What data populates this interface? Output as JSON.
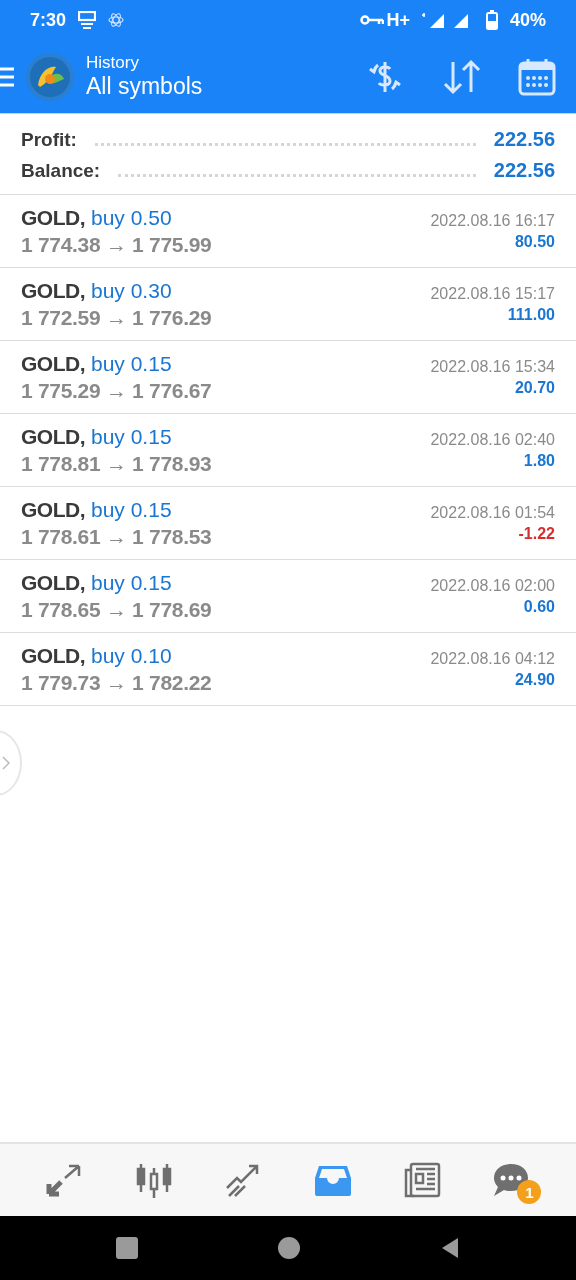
{
  "status_bar": {
    "time": "7:30",
    "network": "H+",
    "battery": "40%"
  },
  "header": {
    "title": "History",
    "subtitle": "All symbols"
  },
  "summary": [
    {
      "label": "Profit:",
      "value": "222.56"
    },
    {
      "label": "Balance:",
      "value": "222.56"
    }
  ],
  "trades": [
    {
      "symbol": "GOLD,",
      "type": "buy 0.50",
      "prices": "1 774.38 → 1 775.99",
      "time": "2022.08.16 16:17",
      "profit": "80.50",
      "color": "#1976d2"
    },
    {
      "symbol": "GOLD,",
      "type": "buy 0.30",
      "prices": "1 772.59 → 1 776.29",
      "time": "2022.08.16 15:17",
      "profit": "111.00",
      "color": "#1976d2"
    },
    {
      "symbol": "GOLD,",
      "type": "buy 0.15",
      "prices": "1 775.29 → 1 776.67",
      "time": "2022.08.16 15:34",
      "profit": "20.70",
      "color": "#1976d2"
    },
    {
      "symbol": "GOLD,",
      "type": "buy 0.15",
      "prices": "1 778.81 → 1 778.93",
      "time": "2022.08.16 02:40",
      "profit": "1.80",
      "color": "#1976d2"
    },
    {
      "symbol": "GOLD,",
      "type": "buy 0.15",
      "prices": "1 778.61 → 1 778.53",
      "time": "2022.08.16 01:54",
      "profit": "-1.22",
      "color": "#d32f2f"
    },
    {
      "symbol": "GOLD,",
      "type": "buy 0.15",
      "prices": "1 778.65 → 1 778.69",
      "time": "2022.08.16 02:00",
      "profit": "0.60",
      "color": "#1976d2"
    },
    {
      "symbol": "GOLD,",
      "type": "buy 0.10",
      "prices": "1 779.73 → 1 782.22",
      "time": "2022.08.16 04:12",
      "profit": "24.90",
      "color": "#1976d2"
    }
  ],
  "bottom_nav": [
    {
      "kind": "quotes",
      "selected": false
    },
    {
      "kind": "chart",
      "selected": false
    },
    {
      "kind": "trade",
      "selected": false
    },
    {
      "kind": "history",
      "selected": true
    },
    {
      "kind": "news",
      "selected": false
    },
    {
      "kind": "chat",
      "selected": false,
      "badge": "1"
    }
  ]
}
